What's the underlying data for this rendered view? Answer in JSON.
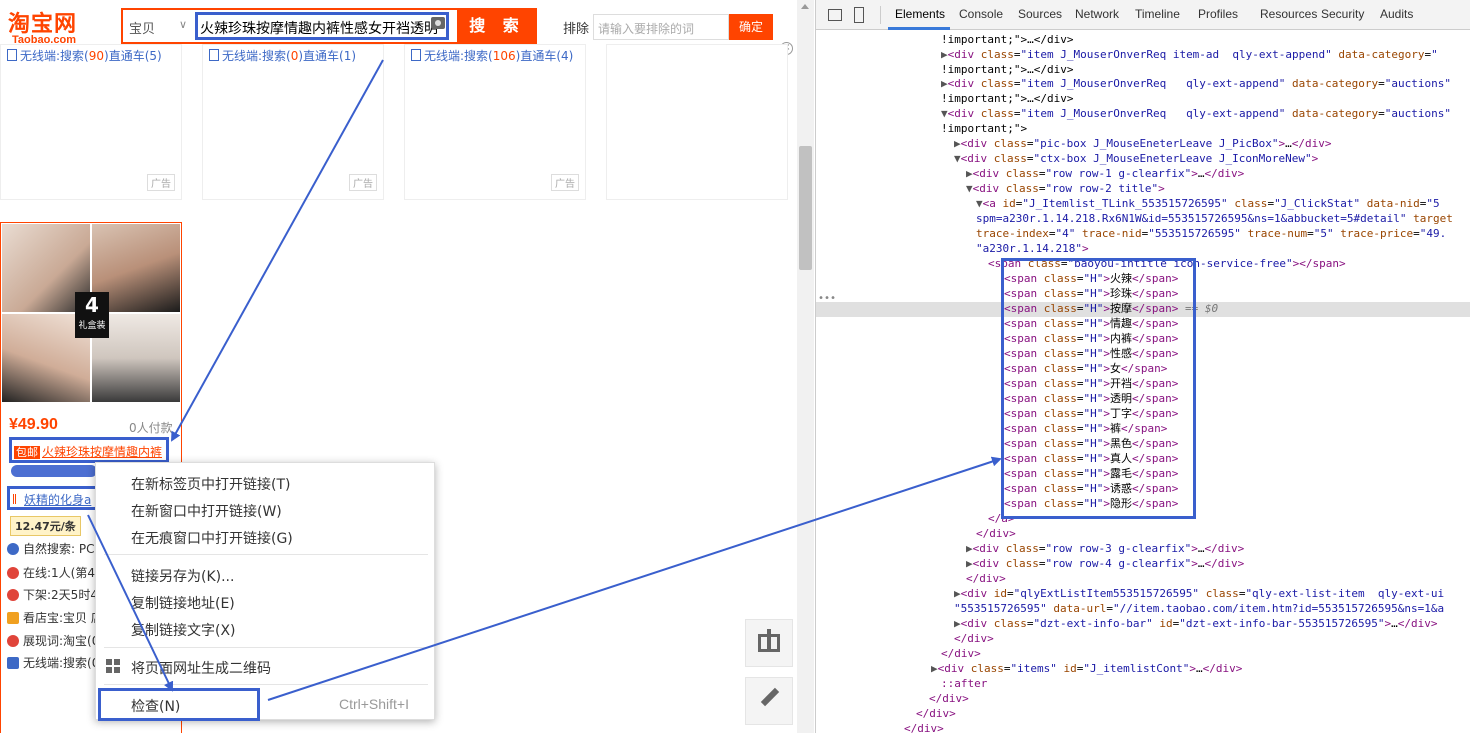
{
  "taobao": {
    "logo_cn": "淘宝网",
    "logo_en": "Taobao.com",
    "search_type": "宝贝",
    "search_query": "火辣珍珠按摩情趣内裤性感女开裆透明",
    "search_button": "搜 索",
    "exclude_label": "排除",
    "exclude_placeholder": "请输入要排除的词",
    "exclude_confirm": "确定",
    "close": "×",
    "top_cards": [
      {
        "stat_prefix": "无线端:搜索(",
        "stat_count": "90",
        "stat_suffix": ")直通车(5)",
        "ad": "广告"
      },
      {
        "stat_prefix": "无线端:搜索(",
        "stat_count": "0",
        "stat_suffix": ")直通车(1)",
        "ad": "广告"
      },
      {
        "stat_prefix": "无线端:搜索(",
        "stat_count": "106",
        "stat_suffix": ")直通车(4)",
        "ad": "广告"
      }
    ],
    "product": {
      "gift_num": "4",
      "gift_label": "礼盒装",
      "price": "¥49.90",
      "paid": "0人付款",
      "baoyou": "包邮",
      "title": "火辣珍珠按摩情趣内裤",
      "shop": "妖精的化身a",
      "per_unit": "12.47元/条",
      "meta": [
        {
          "label": "自然搜索: PC",
          "color": "#3d69c6"
        },
        {
          "label": "在线:1人(第40",
          "color": "#e0443a"
        },
        {
          "label": "下架:2天5时4",
          "color": "#e0443a"
        },
        {
          "label": "看店宝:宝贝 店",
          "color": "#f0a020"
        },
        {
          "label": "展现词:淘宝(0",
          "color": "#e0443a"
        },
        {
          "label": "无线端:搜索(0",
          "color": "#3d69c6"
        }
      ]
    },
    "context_menu": {
      "open_new_tab": "在新标签页中打开链接(T)",
      "open_new_window": "在新窗口中打开链接(W)",
      "open_incognito": "在无痕窗口中打开链接(G)",
      "save_link_as": "链接另存为(K)...",
      "copy_link_address": "复制链接地址(E)",
      "copy_link_text": "复制链接文字(X)",
      "generate_qr": "将页面网址生成二维码",
      "inspect": "检查(N)",
      "inspect_shortcut": "Ctrl+Shift+I"
    }
  },
  "devtools": {
    "tabs": [
      "Elements",
      "Console",
      "Sources",
      "Network",
      "Timeline",
      "Profiles",
      "Resources",
      "Security",
      "Audits"
    ],
    "active_tab": "Elements",
    "selected_marker": "== $0",
    "h_words": [
      "火辣",
      "珍珠",
      "按摩",
      "情趣",
      "内裤",
      "性感",
      "女",
      "开裆",
      "透明",
      "丁字",
      "裤",
      "黑色",
      "真人",
      "露毛",
      "诱惑",
      "隐形"
    ]
  },
  "colors": {
    "taobao_orange": "#ff4400",
    "annotation_blue": "#3a5fcd",
    "devtools_tag": "#881280",
    "devtools_attr": "#994500",
    "devtools_value": "#1a1aa6"
  }
}
